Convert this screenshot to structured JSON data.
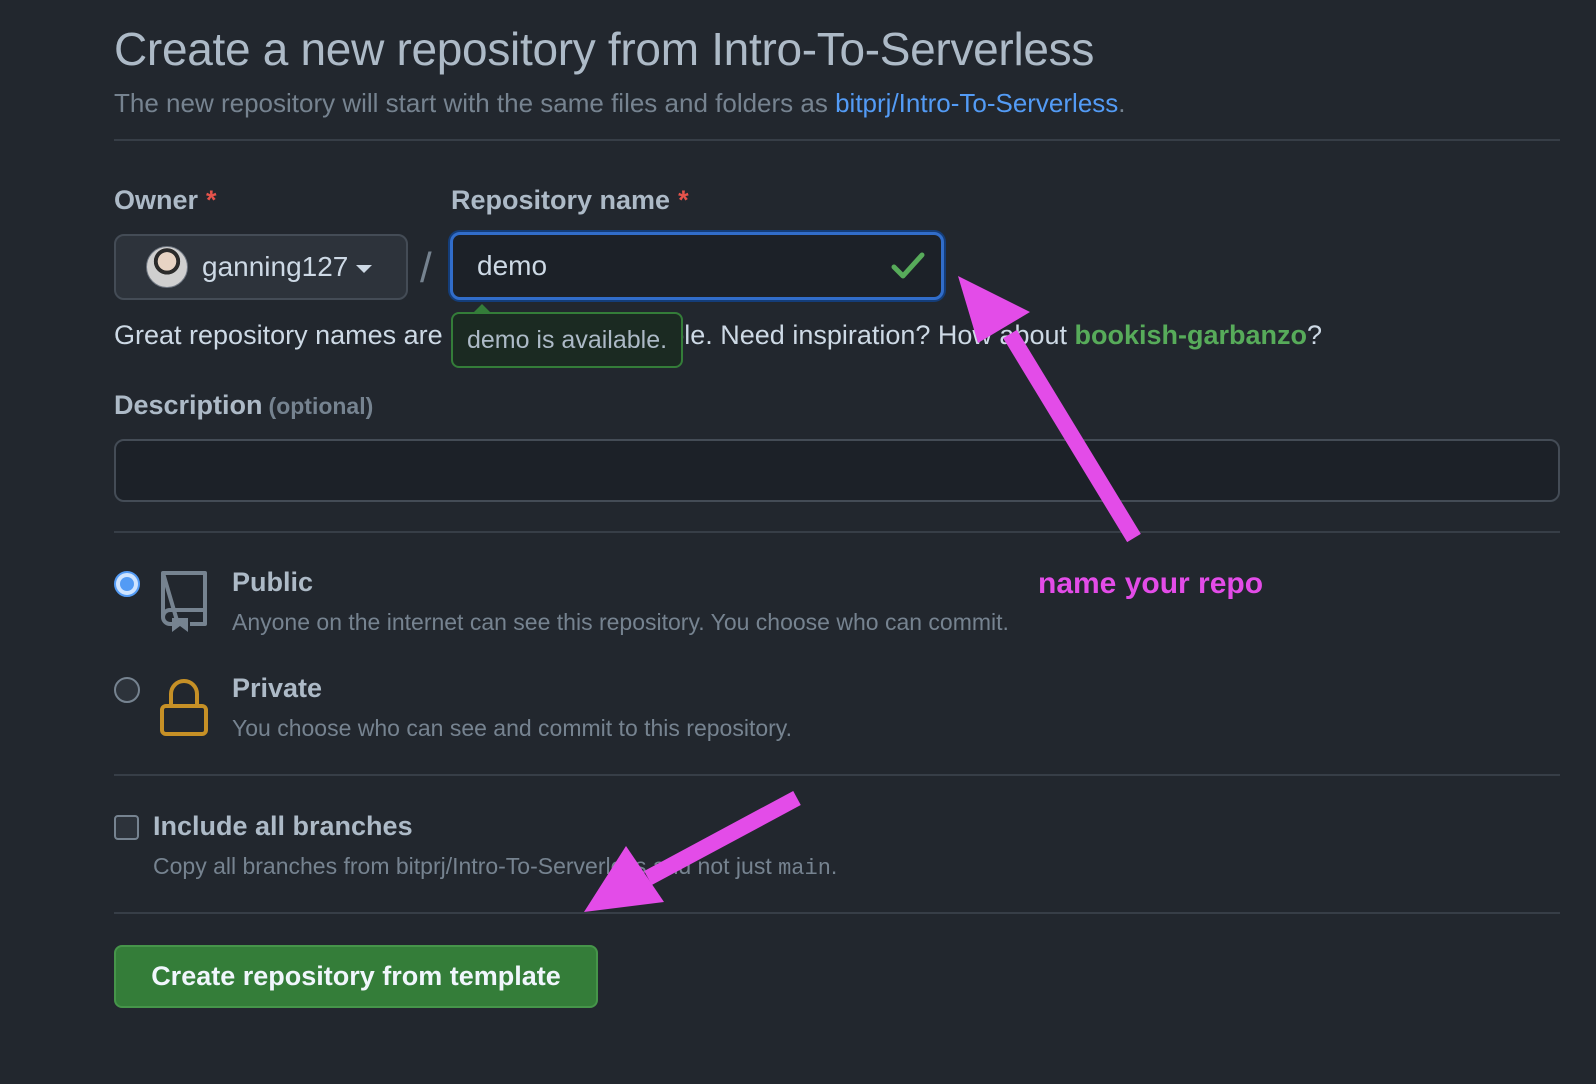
{
  "header": {
    "title": "Create a new repository from Intro-To-Serverless",
    "subtitle_prefix": "The new repository will start with the same files and folders as ",
    "template_link": "bitprj/Intro-To-Serverless",
    "subtitle_suffix": "."
  },
  "owner": {
    "label": "Owner",
    "required_mark": "*",
    "selected": "ganning127"
  },
  "repo_name": {
    "label": "Repository name",
    "required_mark": "*",
    "value": "demo",
    "valid": true,
    "tooltip": "demo is available."
  },
  "name_hint": {
    "prefix": "Great repository names are short and memorable. Need inspiration? How about ",
    "suggestion": "bookish-garbanzo",
    "suffix": "?"
  },
  "description": {
    "label": "Description",
    "optional": "(optional)",
    "value": ""
  },
  "visibility": {
    "public": {
      "title": "Public",
      "description": "Anyone on the internet can see this repository. You choose who can commit.",
      "selected": true
    },
    "private": {
      "title": "Private",
      "description": "You choose who can see and commit to this repository.",
      "selected": false
    }
  },
  "branches": {
    "label": "Include all branches",
    "description_prefix": "Copy all branches from bitprj/Intro-To-Serverless and not just ",
    "branch": "main",
    "description_suffix": ".",
    "checked": false
  },
  "submit": {
    "label": "Create repository from template"
  },
  "annotation": {
    "text": "name your repo",
    "color": "#e34ce8"
  },
  "colors": {
    "background": "#22272e",
    "link": "#539bf5",
    "success": "#57ab5a",
    "button": "#347d39",
    "required": "#e5534b"
  }
}
